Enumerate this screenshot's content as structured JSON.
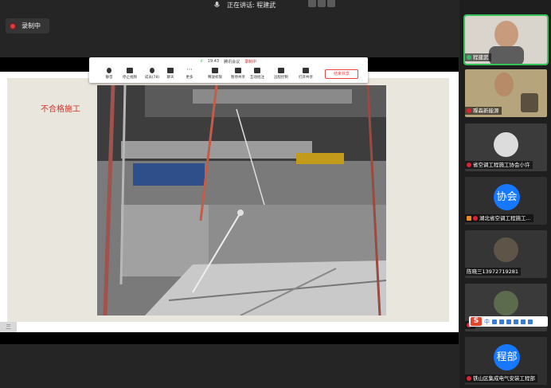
{
  "topbar": {
    "speaking_text": "正在讲话: 程建武"
  },
  "recording": {
    "label": "录制中",
    "color": "#e03b3b"
  },
  "meeting_toolbar": {
    "time": "19:43",
    "app_name": "腾讯会议",
    "recording_label": "录制中",
    "buttons": [
      {
        "label": "静音",
        "icon": "microphone-icon"
      },
      {
        "label": "停止视频",
        "icon": "camera-icon"
      },
      {
        "label": "成员(78)",
        "icon": "members-icon"
      },
      {
        "label": "聊天",
        "icon": "chat-icon"
      },
      {
        "label": "更多",
        "icon": "more-icon"
      },
      {
        "label": "释放权限",
        "icon": "share-release-icon"
      },
      {
        "label": "暂停共享",
        "icon": "pause-share-icon"
      },
      {
        "label": "互动批注",
        "icon": "annotate-icon"
      },
      {
        "label": "远程控制",
        "icon": "remote-control-icon"
      },
      {
        "label": "打开共享",
        "icon": "share-icon"
      }
    ],
    "end_button": "结束共享"
  },
  "slide": {
    "title": "不合格施工",
    "title_color": "#d0342c"
  },
  "participants": [
    {
      "name": "程建武",
      "mic": "on",
      "active": true,
      "kind": "video"
    },
    {
      "name": "璨森新能源",
      "mic": "muted",
      "active": false,
      "kind": "video"
    },
    {
      "name": "省空调工程施工协会小许",
      "mic": "muted",
      "active": false,
      "kind": "video"
    },
    {
      "name": "湖北省空调工程施工...",
      "mic": "muted",
      "active": false,
      "kind": "avatar",
      "avatar_text": "协会"
    },
    {
      "name": "陈晓三13972719281",
      "mic": "none",
      "active": false,
      "kind": "video"
    },
    {
      "name": "",
      "mic": "muted",
      "active": false,
      "kind": "video"
    },
    {
      "name": "铁山区集成电气安装工程部",
      "mic": "muted",
      "active": false,
      "kind": "avatar",
      "avatar_text": "程部"
    }
  ],
  "ime": {
    "logo": "S",
    "mode": "中"
  },
  "side_tab": {
    "label": "三"
  },
  "colors": {
    "accent_blue": "#1677ff",
    "active_green": "#35c25a"
  }
}
